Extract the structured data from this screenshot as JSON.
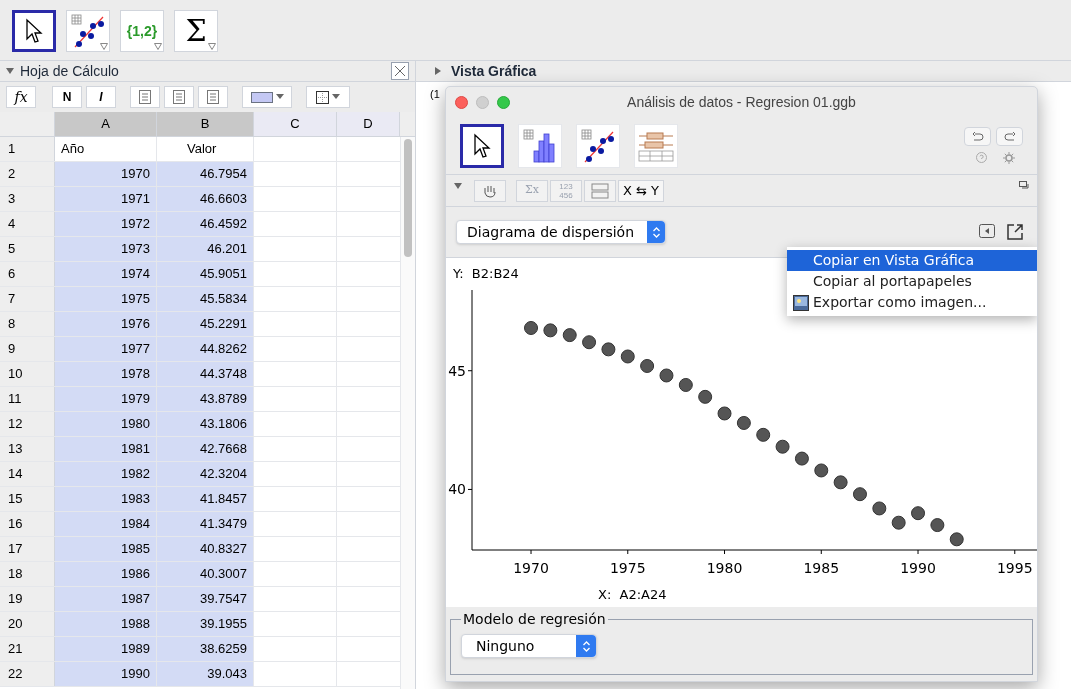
{
  "toolbar": {
    "tools": [
      {
        "kind": "pointer",
        "selected": true
      },
      {
        "kind": "regression",
        "selected": false
      },
      {
        "kind": "list",
        "label": "{1,2}",
        "selected": false
      },
      {
        "kind": "sum",
        "label": "Σ",
        "selected": false
      }
    ]
  },
  "spreadsheet": {
    "title": "Hoja de Cálculo",
    "format_buttons": [
      "fx",
      "N",
      "I"
    ],
    "columns": [
      {
        "label": "A",
        "selected": true
      },
      {
        "label": "B",
        "selected": true
      },
      {
        "label": "C",
        "selected": false
      },
      {
        "label": "D",
        "selected": false
      }
    ],
    "rows": [
      {
        "number": "1",
        "a": "Año",
        "b": "Valor",
        "selected": false
      },
      {
        "number": "2",
        "a": "1970",
        "b": "46.7954",
        "selected": true
      },
      {
        "number": "3",
        "a": "1971",
        "b": "46.6603",
        "selected": true
      },
      {
        "number": "4",
        "a": "1972",
        "b": "46.4592",
        "selected": true
      },
      {
        "number": "5",
        "a": "1973",
        "b": "46.201",
        "selected": true
      },
      {
        "number": "6",
        "a": "1974",
        "b": "45.9051",
        "selected": true
      },
      {
        "number": "7",
        "a": "1975",
        "b": "45.5834",
        "selected": true
      },
      {
        "number": "8",
        "a": "1976",
        "b": "45.2291",
        "selected": true
      },
      {
        "number": "9",
        "a": "1977",
        "b": "44.8262",
        "selected": true
      },
      {
        "number": "10",
        "a": "1978",
        "b": "44.3748",
        "selected": true
      },
      {
        "number": "11",
        "a": "1979",
        "b": "43.8789",
        "selected": true
      },
      {
        "number": "12",
        "a": "1980",
        "b": "43.1806",
        "selected": true
      },
      {
        "number": "13",
        "a": "1981",
        "b": "42.7668",
        "selected": true
      },
      {
        "number": "14",
        "a": "1982",
        "b": "42.3204",
        "selected": true
      },
      {
        "number": "15",
        "a": "1983",
        "b": "41.8457",
        "selected": true
      },
      {
        "number": "16",
        "a": "1984",
        "b": "41.3479",
        "selected": true
      },
      {
        "number": "17",
        "a": "1985",
        "b": "40.8327",
        "selected": true
      },
      {
        "number": "18",
        "a": "1986",
        "b": "40.3007",
        "selected": true
      },
      {
        "number": "19",
        "a": "1987",
        "b": "39.7547",
        "selected": true
      },
      {
        "number": "20",
        "a": "1988",
        "b": "39.1955",
        "selected": true
      },
      {
        "number": "21",
        "a": "1989",
        "b": "38.6259",
        "selected": true
      },
      {
        "number": "22",
        "a": "1990",
        "b": "39.043",
        "selected": true
      }
    ]
  },
  "graphics_view": {
    "title": "Vista Gráfica",
    "clipped_text": "(1"
  },
  "dialog": {
    "title": "Análisis de datos - Regresion 01.ggb",
    "tools": [
      {
        "kind": "pointer",
        "selected": true
      },
      {
        "kind": "histogram",
        "selected": false
      },
      {
        "kind": "regression",
        "selected": false
      },
      {
        "kind": "boxplot",
        "selected": false
      }
    ],
    "sub_toolbar": {
      "sum_label": "Σx",
      "number_lines": [
        "123",
        "456"
      ],
      "swap_label": "X ⇆ Y"
    },
    "plot_type": "Diagrama de dispersión",
    "y_source": "Y:  B2:B24",
    "x_source": "X:  A2:A24",
    "chart_data": {
      "type": "scatter",
      "xlim": [
        1966.95,
        1996.2
      ],
      "ylim": [
        37.45,
        48.4
      ],
      "xticks": [
        1970,
        1975,
        1980,
        1985,
        1990,
        1995
      ],
      "yticks": [
        40,
        45
      ],
      "series": [
        {
          "color": "#555555",
          "x": [
            1970,
            1971,
            1972,
            1973,
            1974,
            1975,
            1976,
            1977,
            1978,
            1979,
            1980,
            1981,
            1982,
            1983,
            1984,
            1985,
            1986,
            1987,
            1988,
            1989,
            1990,
            1991,
            1992
          ],
          "values": [
            46.8,
            46.7,
            46.5,
            46.2,
            45.9,
            45.6,
            45.2,
            44.8,
            44.4,
            43.9,
            43.2,
            42.8,
            42.3,
            41.8,
            41.3,
            40.8,
            40.3,
            39.8,
            39.2,
            38.6,
            39.0,
            38.5,
            37.9
          ]
        }
      ]
    },
    "context_menu": [
      {
        "kind": "text",
        "label": "Copiar en Vista Gráfica",
        "selected": true
      },
      {
        "kind": "text",
        "label": "Copiar al portapapeles",
        "selected": false
      },
      {
        "kind": "image",
        "label": "Exportar como imagen...",
        "selected": false
      }
    ],
    "regression": {
      "legend": "Modelo de regresión",
      "value": "Ninguno"
    }
  }
}
